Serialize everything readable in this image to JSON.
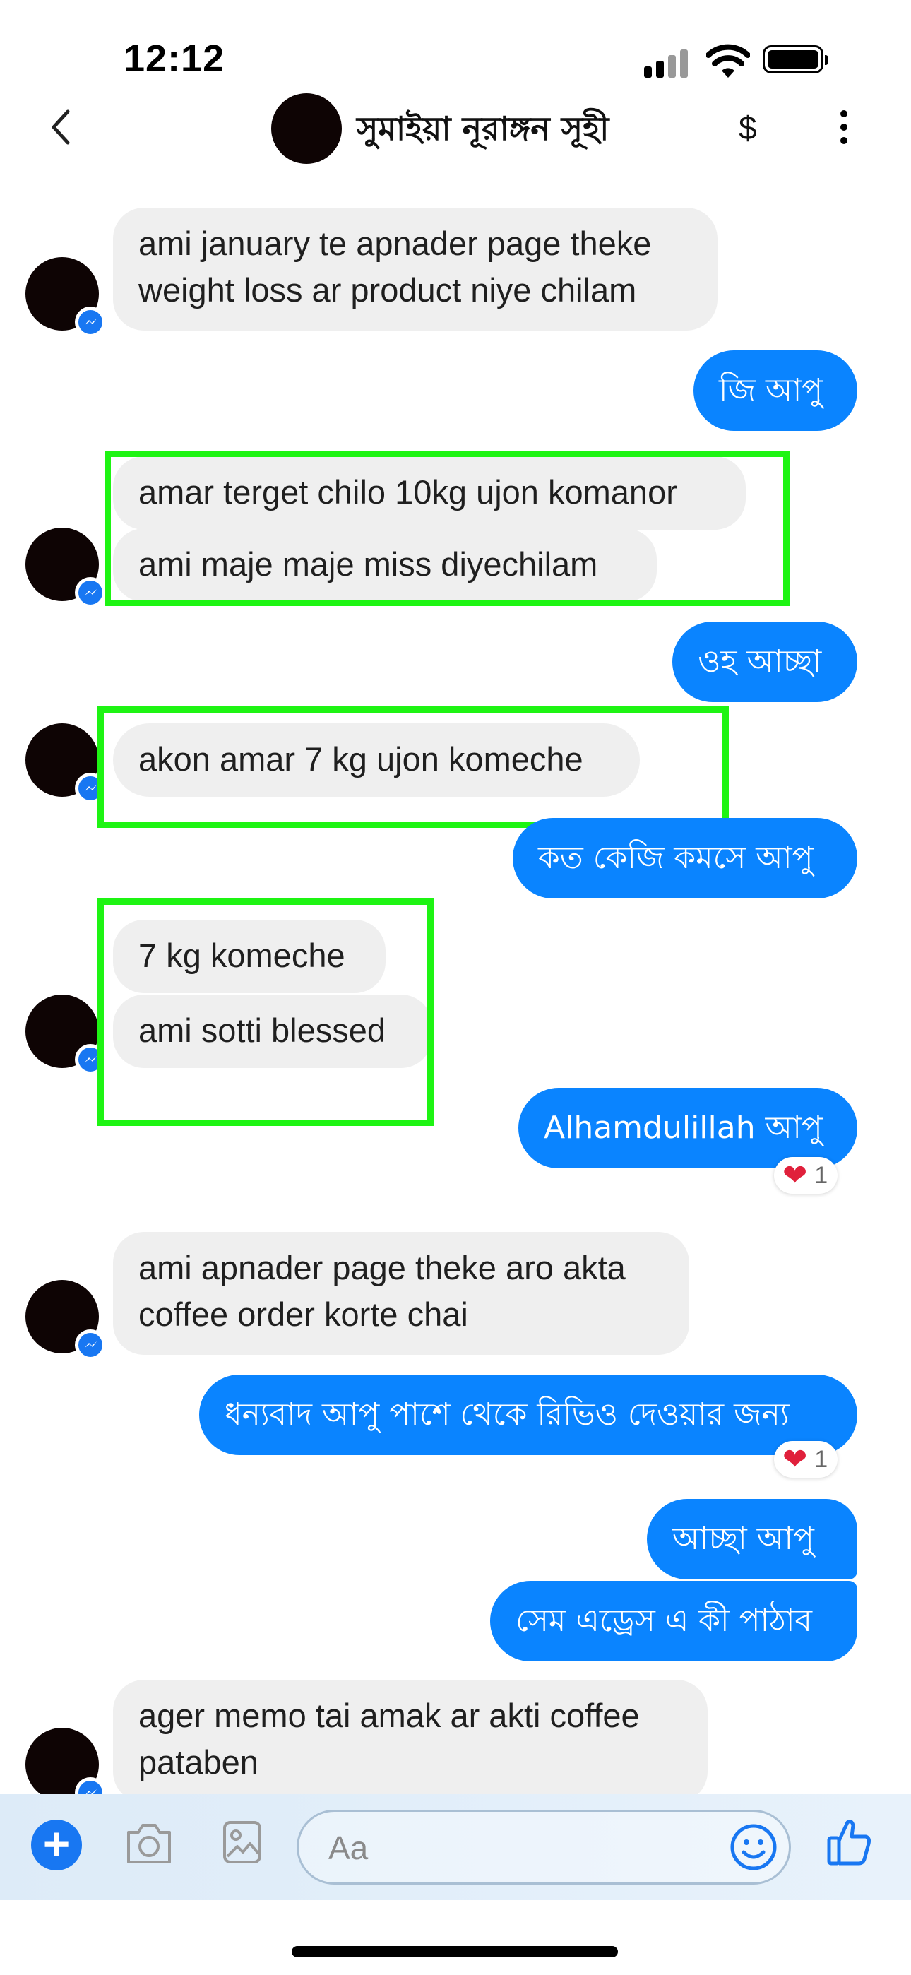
{
  "status": {
    "time": "12:12"
  },
  "header": {
    "name": "সুমাইয়া নূরাঙ্গন সূহী",
    "dollar_label": "$"
  },
  "messages": [
    {
      "side": "in",
      "lines": [
        "ami january te apnader page theke",
        "weight loss ar product niye chilam"
      ]
    },
    {
      "side": "out",
      "lines": [
        "জি আপু"
      ]
    },
    {
      "side": "in",
      "lines": [
        "amar terget chilo 10kg ujon komanor"
      ]
    },
    {
      "side": "in",
      "lines": [
        "ami maje maje miss diyechilam"
      ]
    },
    {
      "side": "out",
      "lines": [
        "ওহ আচ্ছা"
      ]
    },
    {
      "side": "in",
      "lines": [
        "akon amar 7 kg ujon komeche"
      ]
    },
    {
      "side": "out",
      "lines": [
        "কত কেজি কমসে আপু"
      ]
    },
    {
      "side": "in",
      "lines": [
        "7 kg komeche"
      ]
    },
    {
      "side": "in",
      "lines": [
        "ami sotti blessed"
      ]
    },
    {
      "side": "out",
      "lines": [
        "Alhamdulillah আপু"
      ],
      "reaction": {
        "emoji": "❤",
        "count": "1"
      }
    },
    {
      "side": "in",
      "lines": [
        "ami apnader page theke aro akta",
        "coffee order korte chai"
      ]
    },
    {
      "side": "out",
      "lines": [
        "ধন্যবাদ আপু পাশে থেকে রিভিও দেওয়ার জন্য"
      ],
      "reaction": {
        "emoji": "❤",
        "count": "1"
      }
    },
    {
      "side": "out",
      "lines": [
        "আচ্ছা আপু"
      ]
    },
    {
      "side": "out",
      "lines": [
        "সেম এড্রেস এ কী পাঠাব"
      ]
    },
    {
      "side": "in",
      "lines": [
        "ager memo tai amak ar akti coffee",
        "pataben"
      ]
    }
  ],
  "composer": {
    "placeholder": "Aa"
  },
  "colors": {
    "outgoing": "#0a84ff",
    "incoming": "#efefef",
    "highlight": "#1ef413",
    "accent": "#1877f2"
  },
  "icons": [
    "back-chevron-icon",
    "more-icon",
    "plus-icon",
    "camera-icon",
    "image-icon",
    "emoji-icon",
    "thumbs-up-icon",
    "messenger-badge-icon",
    "heart-icon",
    "wifi-icon",
    "battery-icon",
    "signal-icon"
  ]
}
